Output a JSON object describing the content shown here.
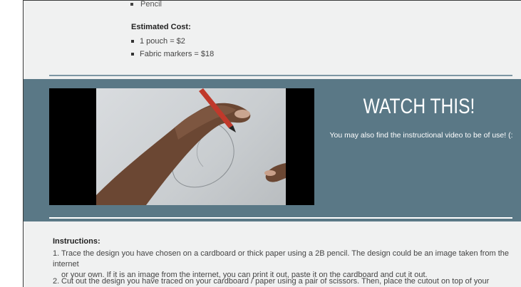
{
  "materials": {
    "last_item_partial": "Pencil"
  },
  "cost": {
    "title": "Estimated Cost:",
    "items": [
      "1 pouch = $2",
      "Fabric markers = $18"
    ]
  },
  "video_section": {
    "title": "WATCH THIS!",
    "subtitle": "You may also find the instructional video to be of use! (:"
  },
  "instructions": {
    "title": "Instructions:",
    "steps": [
      {
        "num": "1.",
        "line1": "Trace the design you have chosen on a cardboard or thick paper using a 2B pencil. The design could be an image taken from the internet",
        "line2": "or your own. If it is an image from the internet, you can print it out, paste it on the cardboard and cut it out."
      },
      {
        "num": "2.",
        "line1": "Cut out the design you have traced on your cardboard / paper using a pair of scissors. Then, place the cutout on top of your canvas bag /"
      }
    ]
  }
}
